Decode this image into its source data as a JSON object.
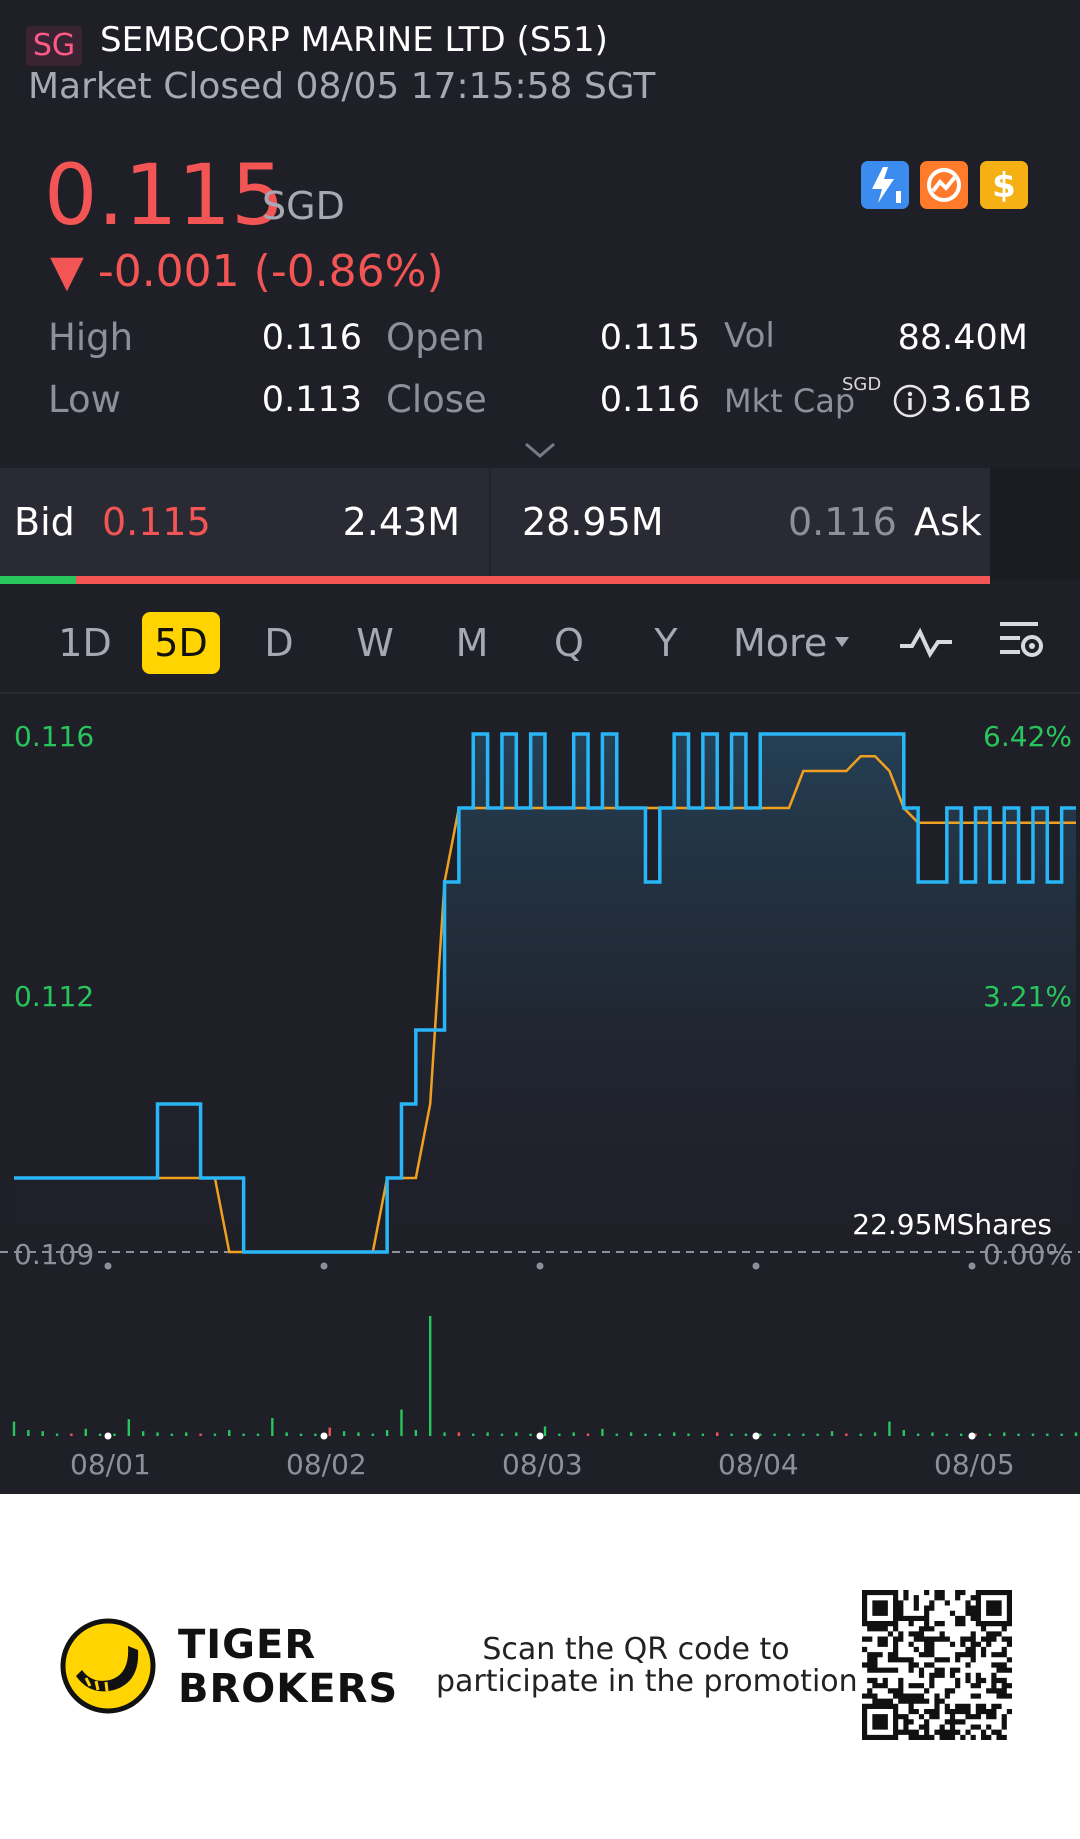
{
  "header": {
    "market_badge": "SG",
    "stock_title": "SEMBCORP MARINE LTD (S51)",
    "market_status": "Market Closed 08/05 17:15:58 SGT",
    "price": "0.115",
    "currency": "SGD",
    "change": "▼ -0.001 (-0.86%)",
    "tag_icons": [
      "lightning-level-icon",
      "chart-badge-icon",
      "dollar-badge-icon"
    ],
    "colors": {
      "down": "#f25554",
      "up": "#27c55c",
      "background": "#1f1f28"
    }
  },
  "stats": {
    "high_label": "High",
    "high": "0.116",
    "low_label": "Low",
    "low": "0.113",
    "open_label": "Open",
    "open": "0.115",
    "close_label": "Close",
    "close": "0.116",
    "vol_label": "Vol",
    "vol": "88.40M",
    "mktcap_label": "Mkt Cap",
    "mktcap_unit": "SGD",
    "mktcap": "3.61B"
  },
  "quote": {
    "bid_label": "Bid",
    "bid_price": "0.115",
    "bid_size": "2.43M",
    "ask_size": "28.95M",
    "ask_price": "0.116",
    "ask_label": "Ask",
    "bid_share": 0.077
  },
  "tabs": [
    "1D",
    "5D",
    "D",
    "W",
    "M",
    "Q",
    "Y",
    "More"
  ],
  "active_tab": "5D",
  "toolbar_icons": [
    "indicator-icon",
    "chart-settings-icon"
  ],
  "chart": {
    "y_left": [
      "0.116",
      "0.112",
      "0.109"
    ],
    "y_right": [
      "6.42%",
      "3.21%",
      "0.00%"
    ],
    "volume_max_label": "22.95MShares",
    "x_labels": [
      "08/01",
      "08/02",
      "08/03",
      "08/04",
      "08/05"
    ]
  },
  "chart_data": {
    "type": "line",
    "x_labels": [
      "08/01",
      "08/02",
      "08/03",
      "08/04",
      "08/05"
    ],
    "ylim": [
      0.109,
      0.116
    ],
    "baseline": 0.109,
    "series": [],
    "price_points": [
      0.11,
      0.11,
      0.11,
      0.11,
      0.11,
      0.11,
      0.11,
      0.11,
      0.11,
      0.11,
      0.111,
      0.111,
      0.111,
      0.11,
      0.11,
      0.11,
      0.109,
      0.109,
      0.109,
      0.109,
      0.109,
      0.109,
      0.109,
      0.109,
      0.109,
      0.109,
      0.11,
      0.111,
      0.112,
      0.112,
      0.114,
      0.115,
      0.116,
      0.115,
      0.116,
      0.115,
      0.116,
      0.115,
      0.115,
      0.116,
      0.115,
      0.116,
      0.115,
      0.115,
      0.114,
      0.115,
      0.116,
      0.115,
      0.116,
      0.115,
      0.116,
      0.115,
      0.116,
      0.116,
      0.116,
      0.116,
      0.116,
      0.116,
      0.116,
      0.116,
      0.116,
      0.116,
      0.115,
      0.114,
      0.114,
      0.115,
      0.114,
      0.115,
      0.114,
      0.115,
      0.114,
      0.115,
      0.114,
      0.115,
      0.115
    ],
    "avg_points": [
      0.11,
      0.11,
      0.11,
      0.11,
      0.11,
      0.11,
      0.11,
      0.11,
      0.11,
      0.11,
      0.11,
      0.11,
      0.11,
      0.11,
      0.11,
      0.109,
      0.109,
      0.109,
      0.109,
      0.109,
      0.109,
      0.109,
      0.109,
      0.109,
      0.109,
      0.109,
      0.11,
      0.11,
      0.11,
      0.111,
      0.114,
      0.115,
      0.115,
      0.115,
      0.115,
      0.115,
      0.115,
      0.115,
      0.115,
      0.115,
      0.115,
      0.115,
      0.115,
      0.115,
      0.115,
      0.115,
      0.115,
      0.115,
      0.115,
      0.115,
      0.115,
      0.115,
      0.115,
      0.115,
      0.115,
      0.1155,
      0.1155,
      0.1155,
      0.1155,
      0.1157,
      0.1157,
      0.1155,
      0.115,
      0.1148,
      0.1148,
      0.1148,
      0.1148,
      0.1148,
      0.1148,
      0.1148,
      0.1148,
      0.1148,
      0.1148,
      0.1148,
      0.1148
    ],
    "volume_points": [
      0.12,
      0.05,
      0.04,
      0.02,
      0.02,
      0.06,
      0.02,
      0.02,
      0.14,
      0.04,
      0.03,
      0.02,
      0.03,
      0.02,
      0.02,
      0.05,
      0.02,
      0.02,
      0.15,
      0.03,
      0.02,
      0.02,
      0.07,
      0.04,
      0.03,
      0.02,
      0.05,
      0.22,
      0.05,
      1.0,
      0.03,
      0.03,
      0.02,
      0.03,
      0.02,
      0.03,
      0.02,
      0.08,
      0.02,
      0.03,
      0.02,
      0.06,
      0.02,
      0.03,
      0.02,
      0.02,
      0.03,
      0.02,
      0.02,
      0.03,
      0.02,
      0.02,
      0.02,
      0.02,
      0.02,
      0.02,
      0.02,
      0.04,
      0.02,
      0.02,
      0.03,
      0.12,
      0.05,
      0.02,
      0.03,
      0.02,
      0.02,
      0.02,
      0.02,
      0.03,
      0.02,
      0.02,
      0.02,
      0.02,
      0.03
    ]
  },
  "promo": {
    "brand_line1": "TIGER",
    "brand_line2": "BROKERS",
    "text_line1": "Scan the QR code to",
    "text_line2": "participate in the promotion"
  }
}
